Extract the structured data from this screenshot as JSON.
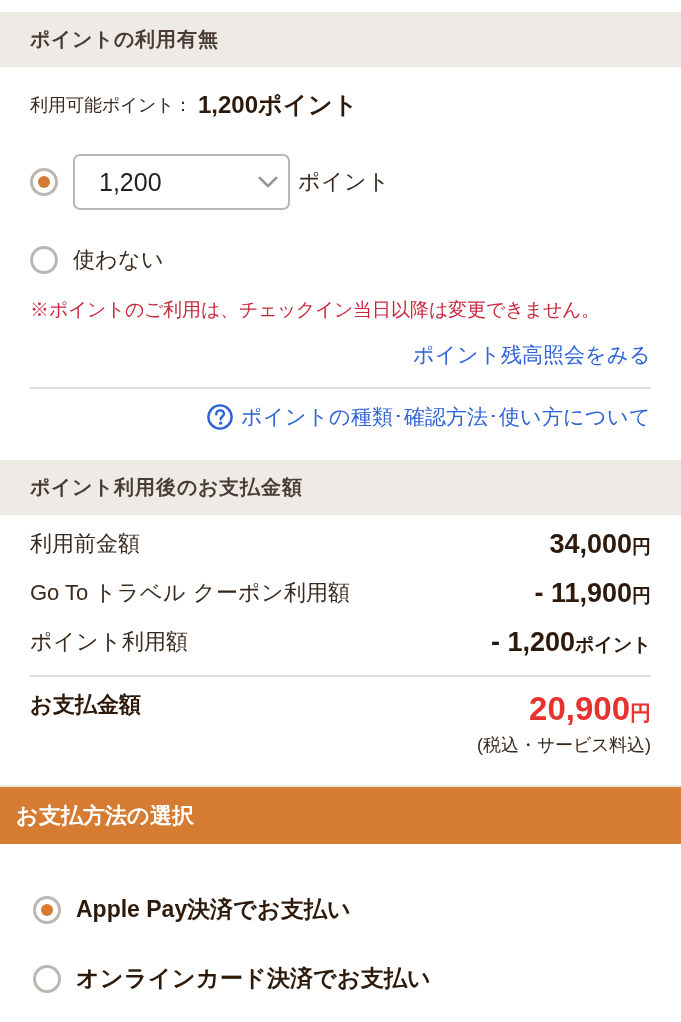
{
  "points_section": {
    "title": "ポイントの利用有無",
    "available_label": "利用可能ポイント：",
    "available_value": "1,200ポイント",
    "options": [
      {
        "kind": "select",
        "selected": true,
        "value": "1,200",
        "unit": "ポイント"
      },
      {
        "kind": "text",
        "selected": false,
        "label": "使わない"
      }
    ],
    "notice": "※ポイントのご利用は、チェックイン当日以降は変更できません。",
    "balance_link": "ポイント残高照会をみる",
    "help_link": "ポイントの種類･確認方法･使い方について"
  },
  "payment_summary": {
    "title": "ポイント利用後のお支払金額",
    "rows": [
      {
        "label": "利用前金額",
        "amount": "34,000",
        "unit": "円"
      },
      {
        "label": "Go To トラベル クーポン利用額",
        "amount": "- 11,900",
        "unit": "円"
      },
      {
        "label": "ポイント利用額",
        "amount": "- 1,200",
        "unit": "ポイント"
      }
    ],
    "total": {
      "label": "お支払金額",
      "amount": "20,900",
      "unit": "円",
      "note": "(税込・サービス料込)"
    }
  },
  "payment_method": {
    "title": "お支払方法の選択",
    "options": [
      {
        "label": "Apple Pay決済でお支払い",
        "selected": true
      },
      {
        "label": "オンラインカード決済でお支払い",
        "selected": false
      }
    ]
  }
}
